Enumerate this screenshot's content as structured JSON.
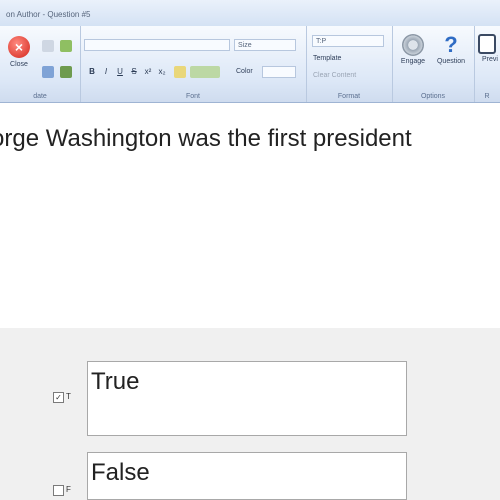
{
  "window": {
    "title": "on Author - Question #5"
  },
  "ribbon": {
    "close_label": "Close",
    "groups": {
      "update": "date",
      "font": "Font",
      "format": "Format",
      "options": "Options",
      "more": "R"
    },
    "font_name_value": "",
    "font_size_label": "Size",
    "color_label": "Color",
    "format_button": "T:P",
    "template_label": "Template",
    "clear_label": "Clear Content",
    "engage_label": "Engage",
    "question_label": "Question",
    "preview_label": "Previ",
    "format_buttons": [
      "B",
      "I",
      "U",
      "S",
      "x²",
      "x₂"
    ]
  },
  "question": {
    "text": "orge Washington was the first president"
  },
  "answers": [
    {
      "short": "T",
      "text": "True",
      "checked": true
    },
    {
      "short": "F",
      "text": "False",
      "checked": false
    }
  ]
}
